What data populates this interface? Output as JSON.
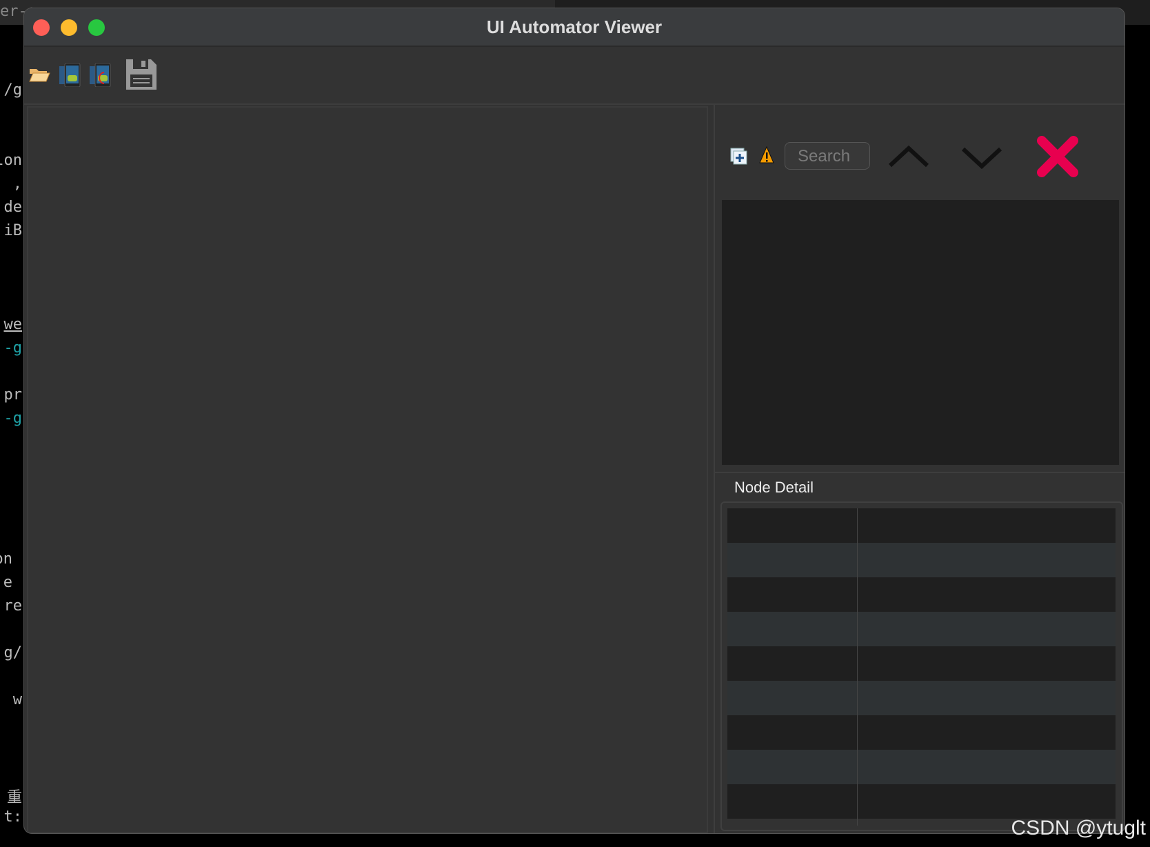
{
  "window": {
    "title": "UI Automator Viewer"
  },
  "background_terminal": {
    "top_text": "er-g",
    "lines": [
      "/g",
      "lon",
      ",",
      "de",
      "iB",
      "we",
      "-g",
      "pr",
      "-g",
      "on",
      "e",
      "re",
      "g/",
      "w",
      "重",
      "t:"
    ]
  },
  "toolbar": {
    "icons": [
      "open-folder-icon",
      "device-screenshot-icon",
      "device-screenshot-compressed-icon",
      "save-icon"
    ]
  },
  "search": {
    "placeholder": "Search",
    "icons": [
      "expand-all-icon",
      "warning-icon",
      "previous-result-icon",
      "next-result-icon",
      "clear-search-icon"
    ]
  },
  "node_detail": {
    "label": "Node Detail",
    "rows": 9
  },
  "watermark": "CSDN @ytuglt",
  "colors": {
    "close": "#fe5f57",
    "minimize": "#febc2e",
    "maximize": "#28c840",
    "clear_x": "#e8004f",
    "warning": "#f59b00"
  }
}
